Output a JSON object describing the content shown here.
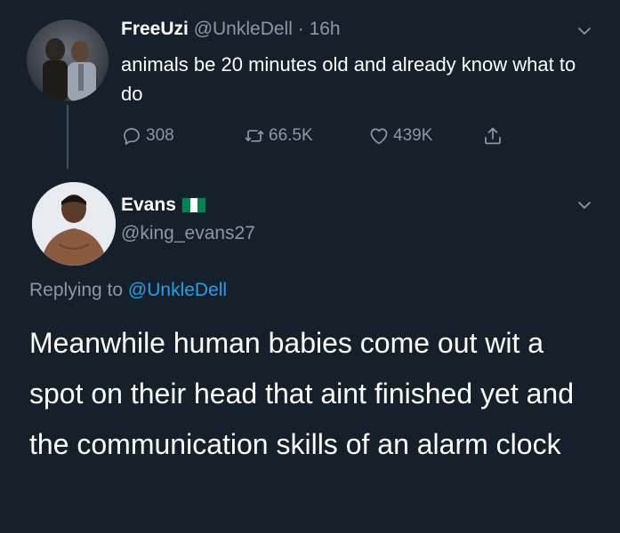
{
  "parent_tweet": {
    "display_name": "FreeUzi",
    "handle": "@UnkleDell",
    "separator": "·",
    "time": "16h",
    "text": "animals be 20 minutes old and already know what to do",
    "reply_count": "308",
    "retweet_count": "66.5K",
    "like_count": "439K",
    "icons": [
      "reply-icon",
      "retweet-icon",
      "like-icon",
      "share-icon",
      "chevron-down-icon"
    ]
  },
  "reply_tweet": {
    "display_name": "Evans",
    "handle": "@king_evans27",
    "flag": "nigeria-flag",
    "flag_colors": [
      "#008751",
      "#ffffff",
      "#008751"
    ],
    "replying_prefix": "Replying to",
    "replying_to": "@UnkleDell",
    "text": "Meanwhile human babies come out wit a spot on their head that aint finished yet and the communication skills of an alarm clock"
  },
  "colors": {
    "background": "#15202b",
    "primary_text": "#ffffff",
    "secondary_text": "#8899a6",
    "accent": "#1da1f2",
    "thread_line": "#3d5466"
  }
}
